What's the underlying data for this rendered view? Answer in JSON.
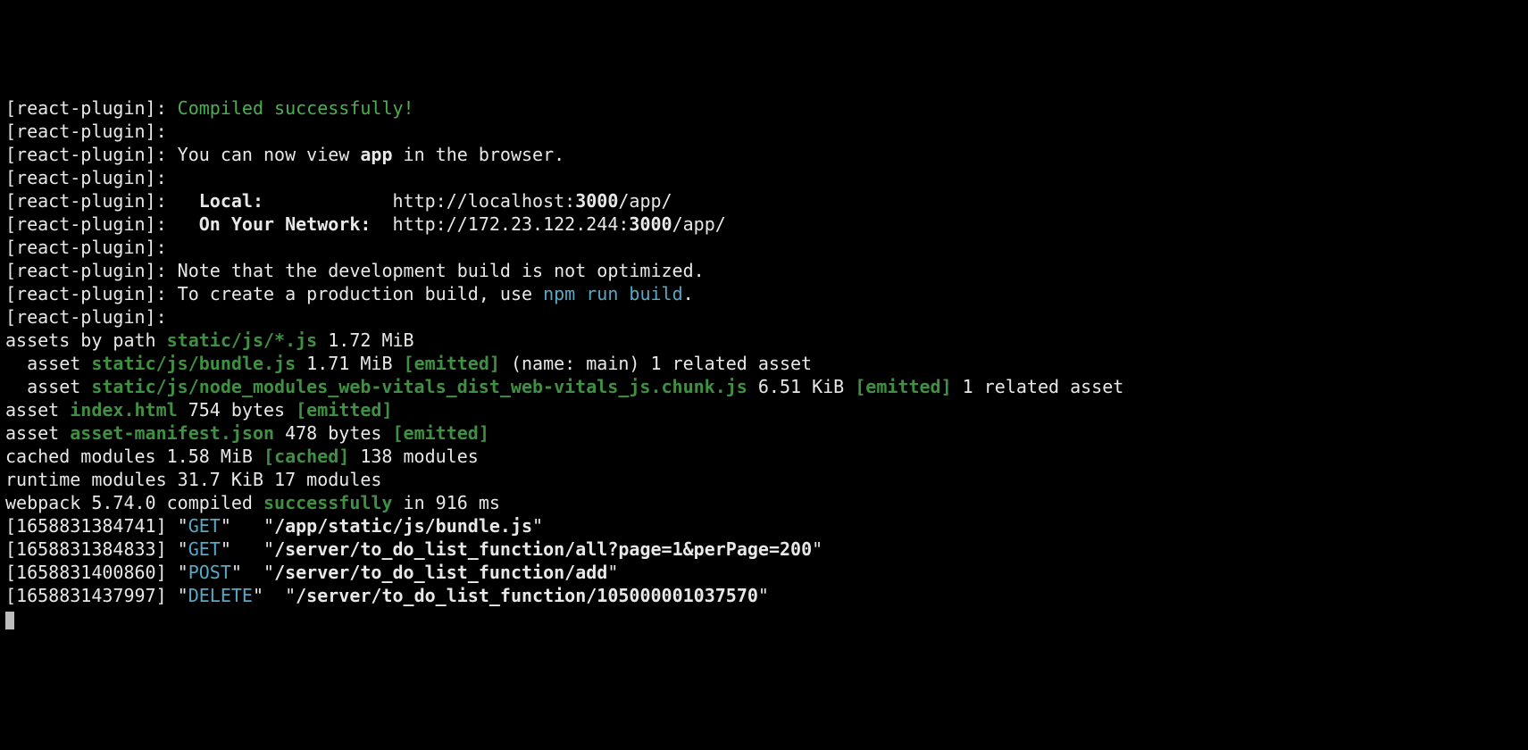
{
  "prefix": "[react-plugin]:",
  "compiled_ok": "Compiled successfully!",
  "view_prefix": "You can now view ",
  "app_name": "app",
  "view_suffix": " in the browser.",
  "local_label": "Local:",
  "local_url_pre": "http://localhost:",
  "local_port": "3000",
  "local_url_post": "/app/",
  "network_label": "On Your Network:",
  "network_url_pre": "http://172.23.122.244:",
  "network_port": "3000",
  "network_url_post": "/app/",
  "note_opt": "Note that the development build is not optimized.",
  "prod_pre": "To create a production build, use ",
  "prod_cmd": "npm run build",
  "prod_post": ".",
  "assets_by_path_pre": "assets by path ",
  "assets_by_path_glob": "static/js/*.js",
  "assets_by_path_size": " 1.72 MiB",
  "bundle_pre": "  asset ",
  "bundle_path": "static/js/bundle.js",
  "bundle_size": " 1.71 MiB ",
  "emitted": "[emitted]",
  "bundle_post": " (name: main) 1 related asset",
  "chunk_pre": "  asset ",
  "chunk_path": "static/js/node_modules_web-vitals_dist_web-vitals_js.chunk.js",
  "chunk_size": " 6.51 KiB ",
  "chunk_post": " 1 related asset",
  "index_pre": "asset ",
  "index_path": "index.html",
  "index_size": " 754 bytes ",
  "manifest_pre": "asset ",
  "manifest_path": "asset-manifest.json",
  "manifest_size": " 478 bytes ",
  "cached_pre": "cached modules 1.58 MiB ",
  "cached_tag": "[cached]",
  "cached_post": " 138 modules",
  "runtime": "runtime modules 31.7 KiB 17 modules",
  "wp_pre": "webpack 5.74.0 compiled ",
  "wp_ok": "successfully",
  "wp_post": " in 916 ms",
  "reqs": [
    {
      "ts": "1658831384741",
      "method": "GET",
      "path": "/app/static/js/bundle.js"
    },
    {
      "ts": "1658831384833",
      "method": "GET",
      "path": "/server/to_do_list_function/all?page=1&perPage=200"
    },
    {
      "ts": "1658831400860",
      "method": "POST",
      "path": "/server/to_do_list_function/add"
    },
    {
      "ts": "1658831437997",
      "method": "DELETE",
      "path": "/server/to_do_list_function/105000001037570"
    }
  ]
}
